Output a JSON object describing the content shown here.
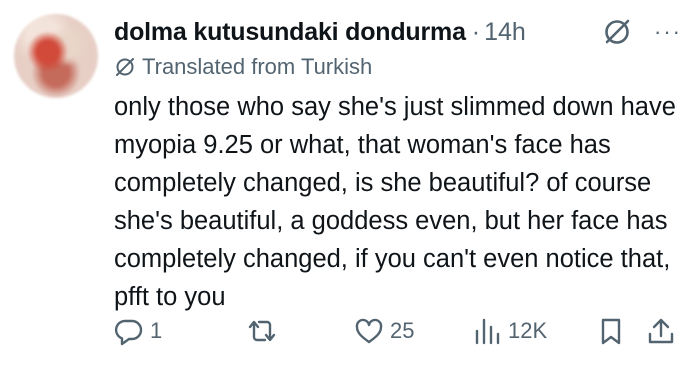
{
  "post": {
    "author_name": "dolma kutusundaki dondurma",
    "separator": "·",
    "time": "14h",
    "translated_label": "Translated from Turkish",
    "text": "only those who say she's just slimmed down have myopia 9.25 or what, that woman's face has completely changed, is she beautiful? of course she's beautiful, a goddess even, but her face has completely changed, if you can't even notice that, pfft to you",
    "more": "···"
  },
  "actions": {
    "reply_count": "1",
    "repost_count": "",
    "like_count": "25",
    "views_count": "12K"
  },
  "icons": {
    "reply": "reply-icon",
    "repost": "repost-icon",
    "like": "heart-icon",
    "views": "views-icon",
    "bookmark": "bookmark-icon",
    "share": "share-icon",
    "grok": "grok-icon",
    "translate": "translate-icon",
    "more": "more-icon"
  },
  "colors": {
    "text": "#0f1419",
    "muted": "#536471"
  }
}
